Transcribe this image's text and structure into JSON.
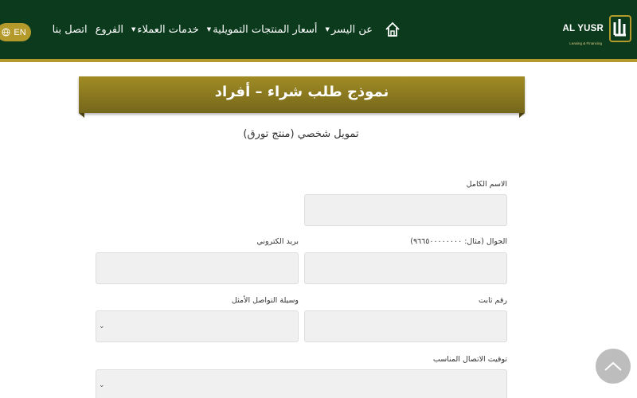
{
  "header": {
    "logo_text": "AL YUSR",
    "logo_subtitle": "Leasing & Financing",
    "nav": [
      {
        "label": "عن اليسر",
        "has_dropdown": true,
        "name": "nav-about"
      },
      {
        "label": "أسعار المنتجات التمويلية",
        "has_dropdown": true,
        "name": "nav-product-prices"
      },
      {
        "label": "خدمات العملاء",
        "has_dropdown": true,
        "name": "nav-customer-services"
      },
      {
        "label": "الفروع",
        "has_dropdown": false,
        "name": "nav-branches"
      },
      {
        "label": "اتصل بنا",
        "has_dropdown": false,
        "name": "nav-contact"
      }
    ],
    "lang_label": "EN"
  },
  "banner": {
    "title": "نموذج طلب شراء – أفراد"
  },
  "subtitle": "تمويل شخصي (منتج تورق)",
  "form": {
    "full_name_label": "الاسم الكامل",
    "mobile_label": "الجوال (مثال: ٩٦٦٥٠٠٠٠٠٠٠٠)",
    "email_label": "بريد الكتروني",
    "landline_label": "رقم ثابت",
    "contact_method_label": "وسيلة التواصل الأمثل",
    "contact_time_label": "توقيت الاتصال المناسب"
  },
  "colors": {
    "header_bg": "#0b3a1d",
    "gold": "#b49a2a",
    "input_bg": "#f0f0f0"
  },
  "icons": {
    "home": "home-icon",
    "globe": "globe-icon",
    "scroll_top": "chevron-up-icon",
    "select": "chevron-down-icon"
  }
}
